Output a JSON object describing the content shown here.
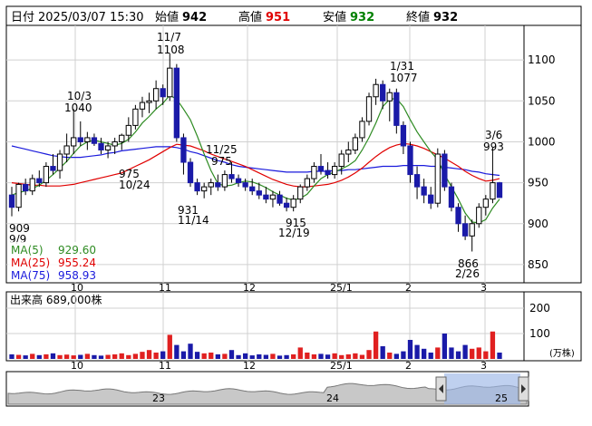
{
  "header": {
    "date_label": "日付",
    "date_value": "2025/03/07 15:30",
    "open_label": "始値",
    "open_value": "942",
    "high_label": "高値",
    "high_value": "951",
    "low_label": "安値",
    "low_value": "932",
    "close_label": "終値",
    "close_value": "932",
    "high_color": "#e00000",
    "low_color": "#008000"
  },
  "ma_legend": [
    {
      "label": "MA(5)",
      "value": "929.60",
      "color": "#2e8b22"
    },
    {
      "label": "MA(25)",
      "value": "955.24",
      "color": "#e00000"
    },
    {
      "label": "MA(75)",
      "value": "958.93",
      "color": "#1a1adc"
    }
  ],
  "volume_label": "出来高 689,000株",
  "volume_unit": "(万株)",
  "volume_ticks": [
    "200",
    "100"
  ],
  "price_ticks": [
    "1100",
    "1050",
    "1000",
    "950",
    "900",
    "850"
  ],
  "month_ticks": [
    "10",
    "11",
    "12",
    "25/1",
    "2",
    "3"
  ],
  "navigator": {
    "labels": [
      "23",
      "24",
      "25"
    ]
  },
  "annotations": [
    {
      "date": "11/7",
      "value": "1108"
    },
    {
      "date": "10/3",
      "value": "1040"
    },
    {
      "date": "1/31",
      "value": "1077"
    },
    {
      "date": "3/6",
      "value": "993"
    },
    {
      "date": "11/25",
      "value": "975"
    },
    {
      "date": "10/24",
      "value": "975"
    },
    {
      "date": "11/14",
      "value": "931"
    },
    {
      "date": "12/19",
      "value": "915"
    },
    {
      "date": "9/9",
      "value": "909"
    },
    {
      "date": "2/26",
      "value": "866"
    }
  ],
  "chart_data": {
    "type": "candlestick",
    "ylim": [
      830,
      1140
    ],
    "yticks": [
      850,
      900,
      950,
      1000,
      1050,
      1100
    ],
    "candles": [
      [
        935,
        945,
        909,
        920
      ],
      [
        920,
        950,
        915,
        948
      ],
      [
        948,
        955,
        935,
        940
      ],
      [
        940,
        960,
        935,
        955
      ],
      [
        955,
        965,
        945,
        950
      ],
      [
        950,
        975,
        945,
        970
      ],
      [
        970,
        985,
        960,
        965
      ],
      [
        965,
        990,
        955,
        985
      ],
      [
        985,
        1010,
        975,
        995
      ],
      [
        995,
        1040,
        985,
        1005
      ],
      [
        1005,
        1025,
        995,
        1000
      ],
      [
        1000,
        1012,
        990,
        1005
      ],
      [
        1005,
        1010,
        995,
        998
      ],
      [
        998,
        1005,
        985,
        990
      ],
      [
        990,
        1000,
        980,
        995
      ],
      [
        995,
        1005,
        985,
        1000
      ],
      [
        1000,
        1010,
        990,
        1008
      ],
      [
        1008,
        1030,
        1000,
        1020
      ],
      [
        1020,
        1045,
        1015,
        1040
      ],
      [
        1040,
        1055,
        1030,
        1048
      ],
      [
        1048,
        1060,
        1035,
        1050
      ],
      [
        1050,
        1075,
        1040,
        1065
      ],
      [
        1065,
        1070,
        1045,
        1055
      ],
      [
        1055,
        1108,
        1050,
        1090
      ],
      [
        1090,
        1095,
        1000,
        1005
      ],
      [
        1005,
        1010,
        960,
        975
      ],
      [
        975,
        980,
        945,
        950
      ],
      [
        950,
        955,
        935,
        940
      ],
      [
        940,
        950,
        931,
        945
      ],
      [
        945,
        955,
        935,
        950
      ],
      [
        950,
        960,
        940,
        945
      ],
      [
        945,
        965,
        940,
        960
      ],
      [
        960,
        975,
        950,
        955
      ],
      [
        955,
        960,
        945,
        950
      ],
      [
        950,
        955,
        940,
        945
      ],
      [
        945,
        955,
        935,
        940
      ],
      [
        940,
        950,
        930,
        935
      ],
      [
        935,
        945,
        925,
        930
      ],
      [
        930,
        940,
        920,
        935
      ],
      [
        935,
        940,
        922,
        925
      ],
      [
        925,
        932,
        915,
        920
      ],
      [
        920,
        935,
        915,
        930
      ],
      [
        930,
        948,
        925,
        945
      ],
      [
        945,
        960,
        940,
        955
      ],
      [
        955,
        975,
        950,
        970
      ],
      [
        970,
        985,
        960,
        965
      ],
      [
        965,
        975,
        955,
        960
      ],
      [
        960,
        975,
        955,
        970
      ],
      [
        970,
        990,
        960,
        985
      ],
      [
        985,
        1000,
        975,
        990
      ],
      [
        990,
        1010,
        985,
        1005
      ],
      [
        1005,
        1030,
        1000,
        1025
      ],
      [
        1025,
        1060,
        1020,
        1055
      ],
      [
        1055,
        1077,
        1045,
        1070
      ],
      [
        1070,
        1075,
        1040,
        1050
      ],
      [
        1050,
        1065,
        1025,
        1060
      ],
      [
        1060,
        1065,
        1010,
        1020
      ],
      [
        1020,
        1025,
        985,
        995
      ],
      [
        995,
        1000,
        950,
        960
      ],
      [
        960,
        970,
        930,
        945
      ],
      [
        945,
        955,
        925,
        935
      ],
      [
        935,
        945,
        918,
        925
      ],
      [
        925,
        992,
        920,
        985
      ],
      [
        985,
        990,
        940,
        945
      ],
      [
        945,
        950,
        915,
        920
      ],
      [
        920,
        925,
        890,
        900
      ],
      [
        900,
        910,
        880,
        885
      ],
      [
        885,
        905,
        866,
        900
      ],
      [
        900,
        925,
        895,
        920
      ],
      [
        920,
        935,
        910,
        930
      ],
      [
        930,
        993,
        925,
        950
      ],
      [
        950,
        951,
        932,
        932
      ]
    ],
    "ma5": [
      935,
      938,
      940,
      943,
      947,
      953,
      960,
      968,
      976,
      986,
      995,
      1000,
      1002,
      1000,
      998,
      996,
      998,
      1003,
      1012,
      1023,
      1031,
      1040,
      1047,
      1057,
      1052,
      1040,
      1027,
      1007,
      985,
      965,
      949,
      946,
      947,
      950,
      952,
      951,
      948,
      944,
      939,
      935,
      931,
      929,
      931,
      936,
      946,
      955,
      960,
      963,
      967,
      971,
      977,
      990,
      1005,
      1023,
      1043,
      1052,
      1053,
      1043,
      1027,
      1012,
      1000,
      988,
      978,
      960,
      945,
      930,
      913,
      902,
      901,
      905,
      919,
      930
    ],
    "ma25": [
      950,
      949,
      948,
      947,
      947,
      946,
      946,
      946,
      947,
      948,
      950,
      952,
      954,
      956,
      958,
      960,
      962,
      966,
      970,
      974,
      978,
      983,
      988,
      993,
      997,
      996,
      995,
      992,
      989,
      985,
      982,
      979,
      976,
      973,
      970,
      966,
      962,
      958,
      954,
      951,
      948,
      946,
      945,
      945,
      946,
      947,
      948,
      950,
      953,
      957,
      962,
      968,
      975,
      982,
      988,
      993,
      996,
      998,
      997,
      995,
      992,
      988,
      984,
      980,
      975,
      970,
      964,
      959,
      955,
      952,
      953,
      955
    ],
    "ma75": [
      995,
      993,
      991,
      989,
      987,
      985,
      983,
      982,
      981,
      981,
      981,
      982,
      983,
      984,
      986,
      987,
      989,
      990,
      991,
      992,
      993,
      994,
      994,
      994,
      993,
      991,
      988,
      986,
      983,
      980,
      977,
      975,
      972,
      970,
      969,
      968,
      967,
      966,
      965,
      964,
      963,
      963,
      963,
      963,
      964,
      964,
      964,
      965,
      965,
      966,
      966,
      967,
      968,
      969,
      970,
      970,
      970,
      971,
      971,
      971,
      971,
      970,
      970,
      969,
      968,
      967,
      966,
      964,
      963,
      961,
      960,
      959
    ],
    "volume": [
      18,
      16,
      14,
      20,
      15,
      18,
      22,
      15,
      17,
      14,
      16,
      20,
      15,
      13,
      16,
      18,
      22,
      15,
      20,
      28,
      35,
      25,
      30,
      95,
      55,
      30,
      60,
      28,
      22,
      25,
      18,
      20,
      35,
      15,
      22,
      14,
      18,
      16,
      20,
      13,
      15,
      18,
      45,
      25,
      18,
      20,
      17,
      22,
      15,
      18,
      22,
      16,
      35,
      108,
      50,
      25,
      20,
      30,
      75,
      55,
      40,
      25,
      45,
      100,
      45,
      30,
      55,
      40,
      45,
      30,
      108,
      25
    ],
    "volume_ylim": [
      0,
      250
    ]
  }
}
